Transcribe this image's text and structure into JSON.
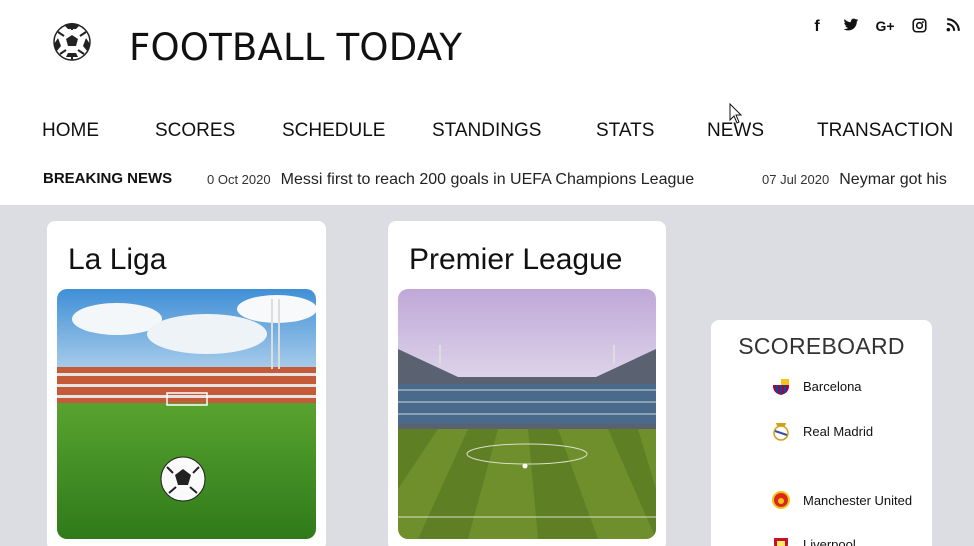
{
  "site": {
    "title": "FOOTBALL TODAY",
    "logo_icon": "soccer-ball-icon"
  },
  "social": [
    {
      "icon": "facebook-icon",
      "glyph": "f"
    },
    {
      "icon": "twitter-icon",
      "glyph": "🐦"
    },
    {
      "icon": "google-plus-icon",
      "glyph": "G+"
    },
    {
      "icon": "instagram-icon",
      "glyph": "◎"
    },
    {
      "icon": "rss-icon",
      "glyph": "⋰"
    }
  ],
  "nav": [
    "HOME",
    "SCORES",
    "SCHEDULE",
    "STANDINGS",
    "STATS",
    "NEWS",
    "TRANSACTION"
  ],
  "breaking": {
    "label": "BREAKING NEWS",
    "items": [
      {
        "date": "0 Oct 2020",
        "headline": "Messi first to reach 200 goals in UEFA Champions League"
      },
      {
        "date": "07 Jul 2020",
        "headline": "Neymar got his"
      }
    ]
  },
  "cards": [
    {
      "title": "La Liga",
      "image": "stadium-with-ball-photo"
    },
    {
      "title": "Premier League",
      "image": "stadium-pitch-photo"
    }
  ],
  "scoreboard": {
    "title": "SCOREBOARD",
    "teams": [
      {
        "name": "Barcelona",
        "crest": "barcelona-crest-icon"
      },
      {
        "name": "Real Madrid",
        "crest": "real-madrid-crest-icon"
      },
      {
        "name": "Manchester United",
        "crest": "manchester-united-crest-icon"
      },
      {
        "name": "Liverpool",
        "crest": "liverpool-crest-icon"
      }
    ]
  }
}
